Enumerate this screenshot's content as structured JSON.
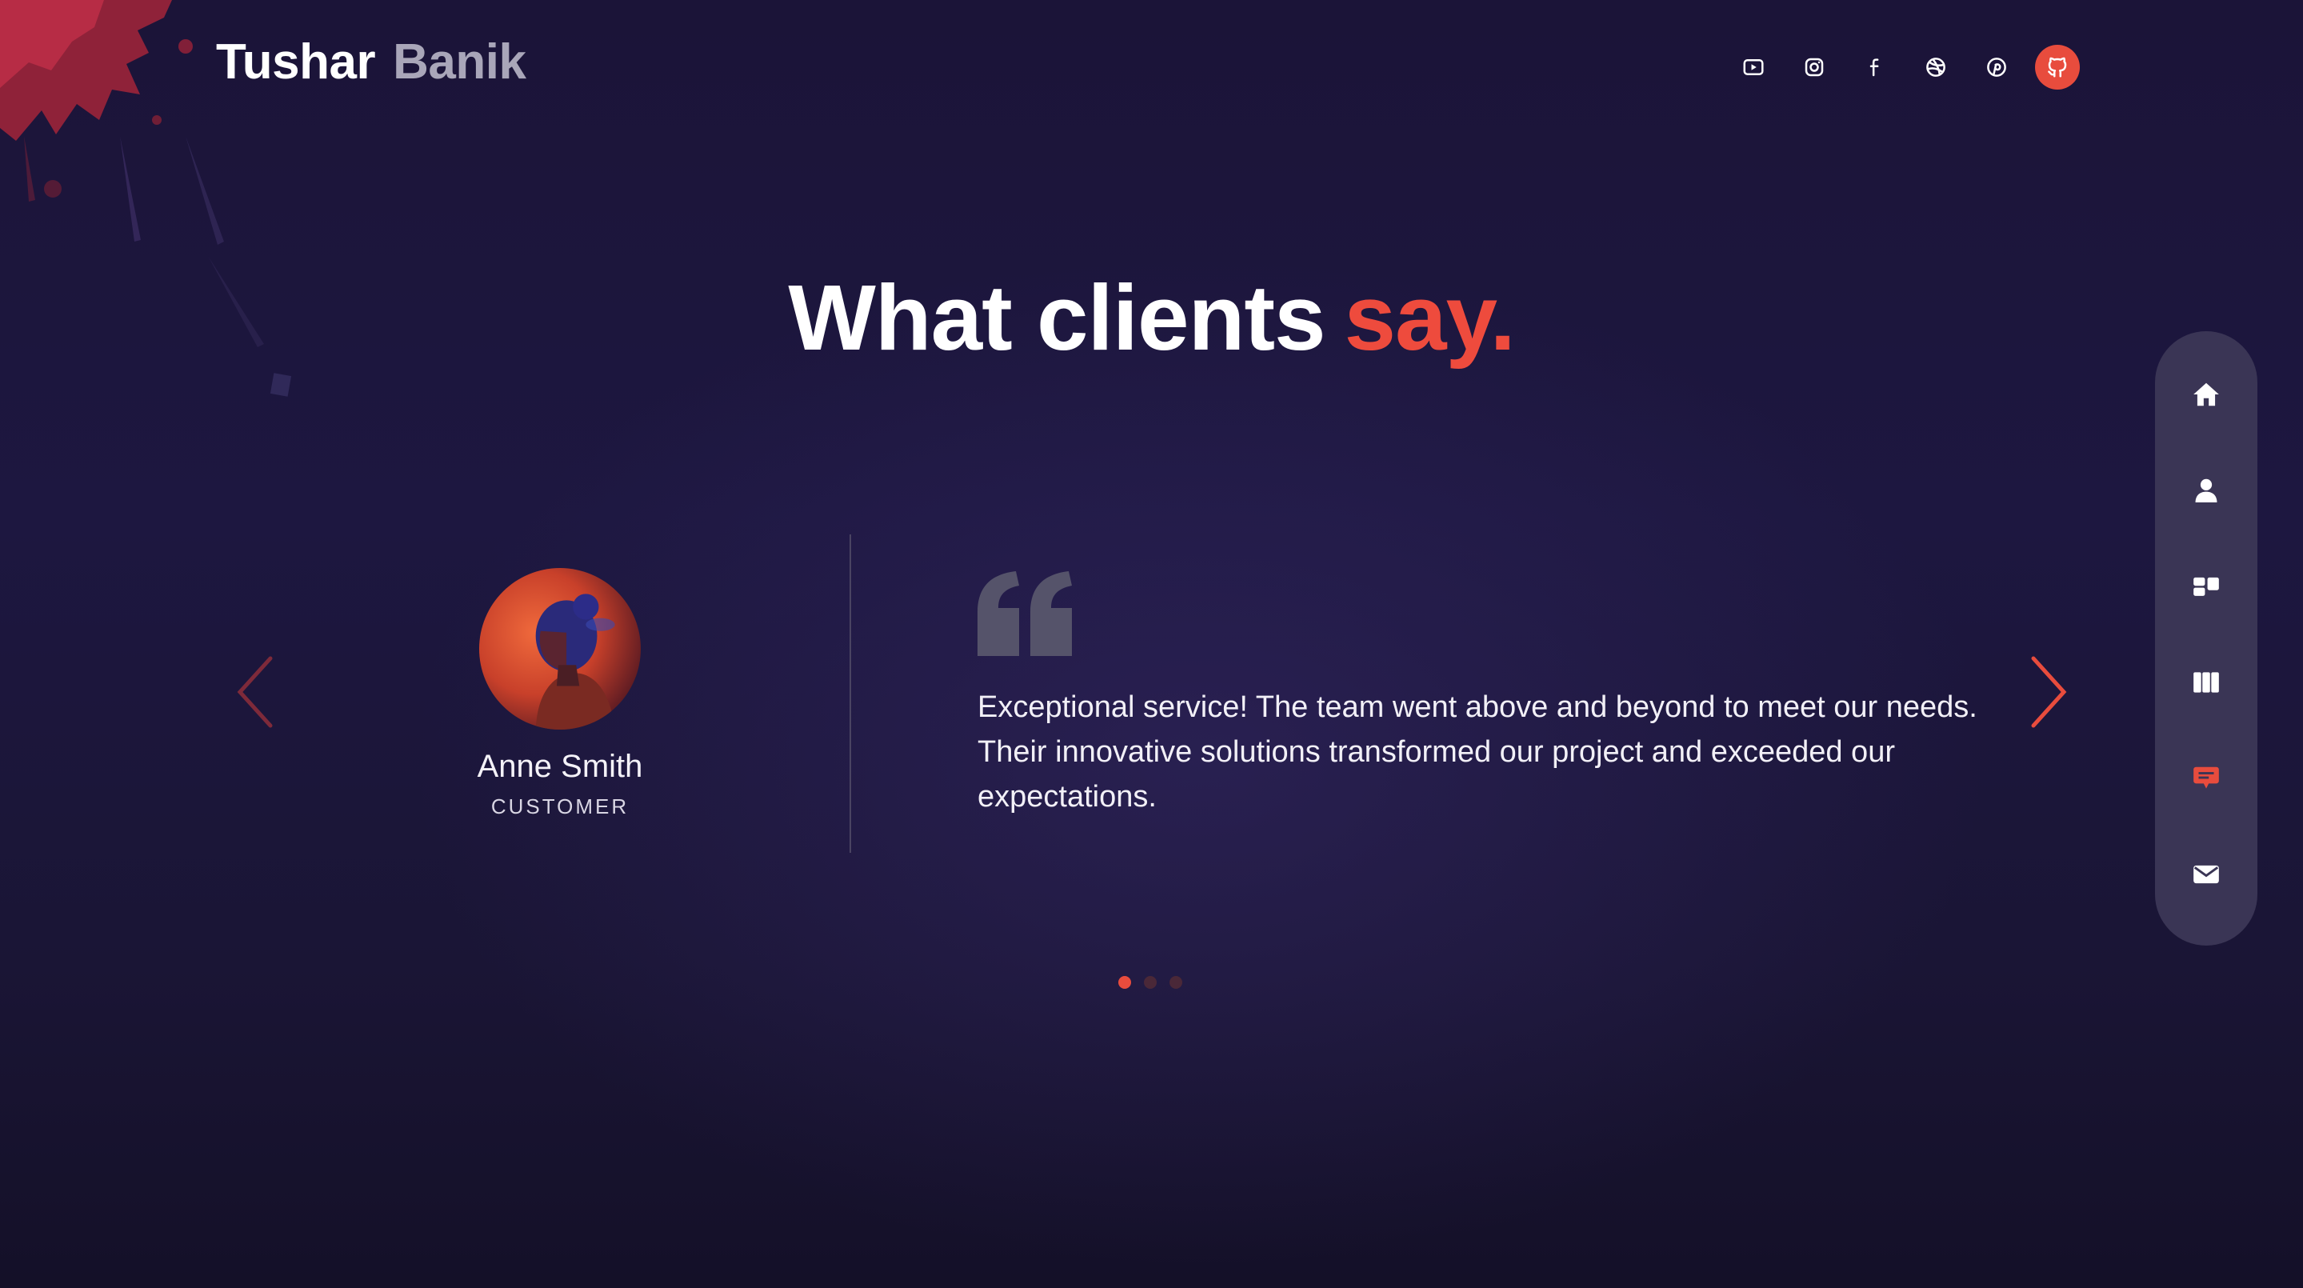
{
  "header": {
    "logo_first": "Tushar",
    "logo_last": "Banik",
    "social_icons": [
      "youtube-icon",
      "instagram-icon",
      "facebook-icon",
      "dribbble-icon",
      "pinterest-icon",
      "github-icon"
    ]
  },
  "section": {
    "title_main": "What clients",
    "title_accent": "say."
  },
  "testimonial": {
    "name": "Anne Smith",
    "role": "CUSTOMER",
    "quote": "Exceptional service! The team went above and beyond to meet our needs. Their innovative solutions transformed our project and exceeded our expectations."
  },
  "carousel": {
    "slide_count": 3,
    "active_index": 0
  },
  "sidenav": {
    "items": [
      "home-icon",
      "user-icon",
      "services-icon",
      "portfolio-icon",
      "testimonials-icon",
      "contact-icon"
    ],
    "active_index": 4
  },
  "colors": {
    "accent": "#e84c3d",
    "background": "#1b1438",
    "sidenav": "#3a3555",
    "logo_secondary": "#a9a6b9"
  }
}
